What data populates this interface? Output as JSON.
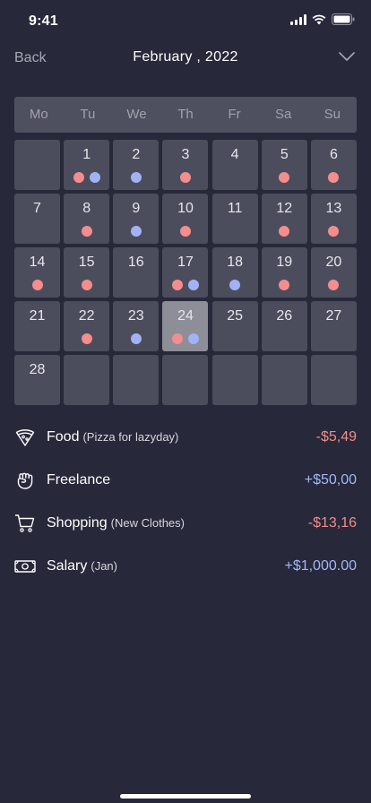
{
  "status_bar": {
    "time": "9:41"
  },
  "header": {
    "back_label": "Back",
    "month_title": "February , 2022",
    "chevron": "chevron-down-icon"
  },
  "weekdays": [
    "Mo",
    "Tu",
    "We",
    "Th",
    "Fr",
    "Sa",
    "Su"
  ],
  "calendar": {
    "selected_day": "24",
    "days": [
      {
        "num": "",
        "dots": []
      },
      {
        "num": "1",
        "dots": [
          "red",
          "blue"
        ]
      },
      {
        "num": "2",
        "dots": [
          "blue"
        ]
      },
      {
        "num": "3",
        "dots": [
          "red"
        ]
      },
      {
        "num": "4",
        "dots": []
      },
      {
        "num": "5",
        "dots": [
          "red"
        ]
      },
      {
        "num": "6",
        "dots": [
          "red"
        ]
      },
      {
        "num": "7",
        "dots": []
      },
      {
        "num": "8",
        "dots": [
          "red"
        ]
      },
      {
        "num": "9",
        "dots": [
          "blue"
        ]
      },
      {
        "num": "10",
        "dots": [
          "red"
        ]
      },
      {
        "num": "11",
        "dots": []
      },
      {
        "num": "12",
        "dots": [
          "red"
        ]
      },
      {
        "num": "13",
        "dots": [
          "red"
        ]
      },
      {
        "num": "14",
        "dots": [
          "red"
        ]
      },
      {
        "num": "15",
        "dots": [
          "red"
        ]
      },
      {
        "num": "16",
        "dots": []
      },
      {
        "num": "17",
        "dots": [
          "red",
          "blue"
        ]
      },
      {
        "num": "18",
        "dots": [
          "blue"
        ]
      },
      {
        "num": "19",
        "dots": [
          "red"
        ]
      },
      {
        "num": "20",
        "dots": [
          "red"
        ]
      },
      {
        "num": "21",
        "dots": []
      },
      {
        "num": "22",
        "dots": [
          "red"
        ]
      },
      {
        "num": "23",
        "dots": [
          "blue"
        ]
      },
      {
        "num": "24",
        "dots": [
          "red",
          "blue"
        ]
      },
      {
        "num": "25",
        "dots": []
      },
      {
        "num": "26",
        "dots": []
      },
      {
        "num": "27",
        "dots": []
      },
      {
        "num": "28",
        "dots": []
      },
      {
        "num": "",
        "dots": []
      },
      {
        "num": "",
        "dots": []
      },
      {
        "num": "",
        "dots": []
      },
      {
        "num": "",
        "dots": []
      },
      {
        "num": "",
        "dots": []
      },
      {
        "num": "",
        "dots": []
      }
    ]
  },
  "transactions": [
    {
      "icon": "pizza-icon",
      "title": "Food",
      "note": "(Pizza for lazyday)",
      "amount": "-$5,49",
      "sign": "neg"
    },
    {
      "icon": "fist-icon",
      "title": "Freelance",
      "note": "",
      "amount": "+$50,00",
      "sign": "pos"
    },
    {
      "icon": "cart-icon",
      "title": "Shopping",
      "note": "(New Clothes)",
      "amount": "-$13,16",
      "sign": "neg"
    },
    {
      "icon": "banknote-icon",
      "title": "Salary",
      "note": "(Jan)",
      "amount": "+$1,000.00",
      "sign": "pos"
    }
  ],
  "colors": {
    "background": "#27283a",
    "cell": "#4c4d5c",
    "selected_cell": "#8d8e98",
    "expense": "#f28c8c",
    "income": "#a4b6f6"
  }
}
